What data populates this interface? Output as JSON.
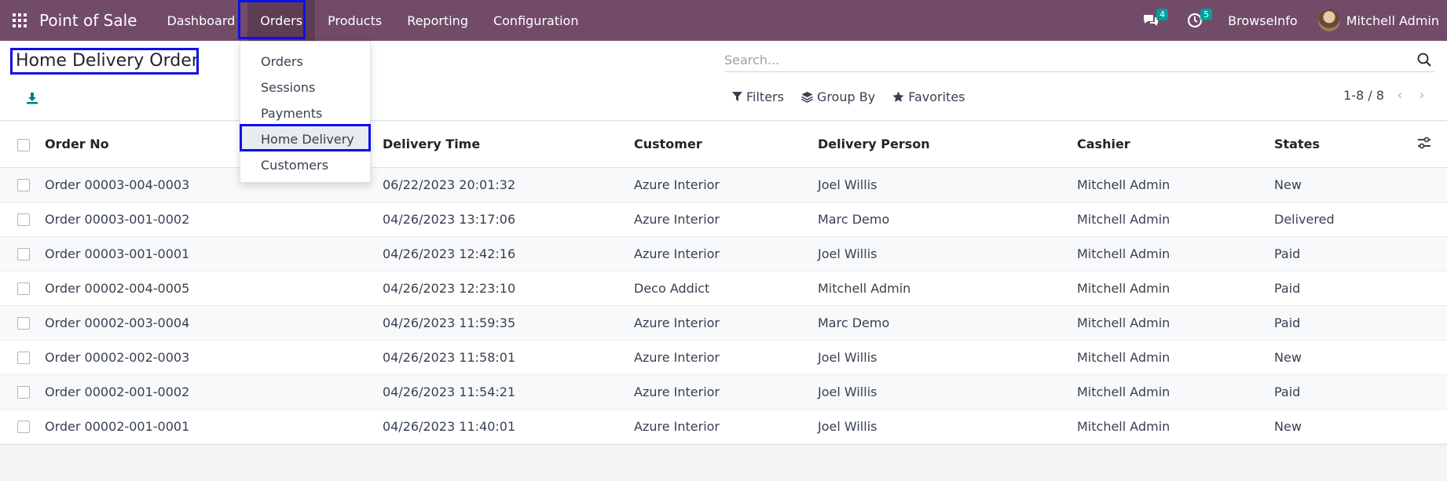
{
  "navbar": {
    "app_title": "Point of Sale",
    "menu": [
      "Dashboard",
      "Orders",
      "Products",
      "Reporting",
      "Configuration"
    ],
    "messages_count": "4",
    "activities_count": "5",
    "company": "BrowseInfo",
    "user": "Mitchell Admin"
  },
  "orders_menu": {
    "items": [
      "Orders",
      "Sessions",
      "Payments",
      "Home Delivery",
      "Customers"
    ]
  },
  "control": {
    "page_title": "Home Delivery Order",
    "search_placeholder": "Search...",
    "filters_label": "Filters",
    "groupby_label": "Group By",
    "favorites_label": "Favorites",
    "pager": "1-8 / 8"
  },
  "table": {
    "headers": [
      "Order No",
      "Delivery Time",
      "Customer",
      "Delivery Person",
      "Cashier",
      "States"
    ],
    "rows": [
      [
        "Order 00003-004-0003",
        "06/22/2023 20:01:32",
        "Azure Interior",
        "Joel Willis",
        "Mitchell Admin",
        "New"
      ],
      [
        "Order 00003-001-0002",
        "04/26/2023 13:17:06",
        "Azure Interior",
        "Marc Demo",
        "Mitchell Admin",
        "Delivered"
      ],
      [
        "Order 00003-001-0001",
        "04/26/2023 12:42:16",
        "Azure Interior",
        "Joel Willis",
        "Mitchell Admin",
        "Paid"
      ],
      [
        "Order 00002-004-0005",
        "04/26/2023 12:23:10",
        "Deco Addict",
        "Mitchell Admin",
        "Mitchell Admin",
        "Paid"
      ],
      [
        "Order 00002-003-0004",
        "04/26/2023 11:59:35",
        "Azure Interior",
        "Marc Demo",
        "Mitchell Admin",
        "Paid"
      ],
      [
        "Order 00002-002-0003",
        "04/26/2023 11:58:01",
        "Azure Interior",
        "Joel Willis",
        "Mitchell Admin",
        "New"
      ],
      [
        "Order 00002-001-0002",
        "04/26/2023 11:54:21",
        "Azure Interior",
        "Joel Willis",
        "Mitchell Admin",
        "Paid"
      ],
      [
        "Order 00002-001-0001",
        "04/26/2023 11:40:01",
        "Azure Interior",
        "Joel Willis",
        "Mitchell Admin",
        "New"
      ]
    ]
  },
  "colors": {
    "navbar": "#714b67",
    "highlight": "#1010e6",
    "badge": "#00a09d",
    "download_icon": "#017e84"
  }
}
